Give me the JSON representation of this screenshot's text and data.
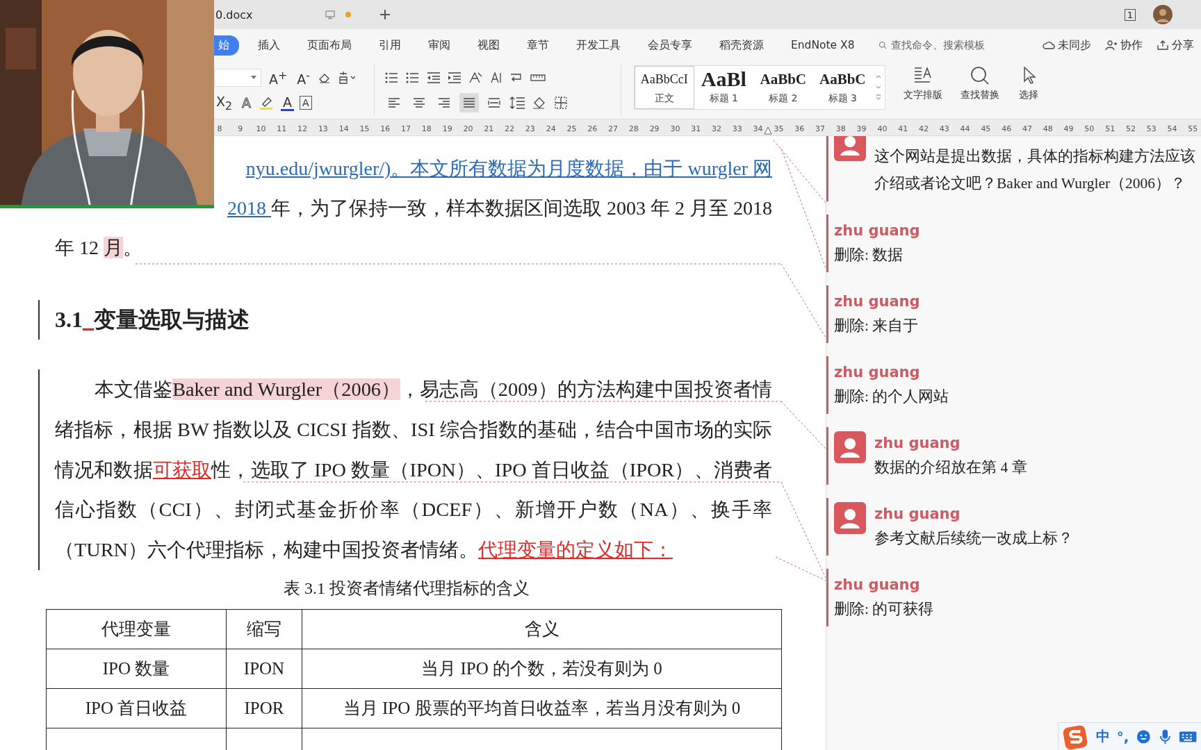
{
  "tab": {
    "title": "0.docx",
    "unsaved": true
  },
  "window_count": "1",
  "menu": [
    {
      "label": "始",
      "selected": true
    },
    {
      "label": "插入",
      "selected": false
    },
    {
      "label": "页面布局",
      "selected": false
    },
    {
      "label": "引用",
      "selected": false
    },
    {
      "label": "审阅",
      "selected": false
    },
    {
      "label": "视图",
      "selected": false
    },
    {
      "label": "章节",
      "selected": false
    },
    {
      "label": "开发工具",
      "selected": false
    },
    {
      "label": "会员专享",
      "selected": false
    },
    {
      "label": "稻壳资源",
      "selected": false
    },
    {
      "label": "EndNote X8",
      "selected": false
    }
  ],
  "search": {
    "placeholder": "查找命令、搜索模板"
  },
  "menu_right": [
    {
      "label": "未同步",
      "kind": "cloud"
    },
    {
      "label": "协作",
      "kind": "people"
    },
    {
      "label": "分享",
      "kind": "share"
    }
  ],
  "font_row1": [
    {
      "glyph": "A$^{+}$"
    },
    {
      "glyph": "A$^{-}$"
    }
  ],
  "font_row2": [
    {
      "glyph": "X$_{2}$",
      "kind": "plain"
    },
    {
      "glyph": "A",
      "kind": "outline"
    },
    {
      "kind": "highlight"
    },
    {
      "glyph": "A",
      "kind": "color"
    },
    {
      "glyph": "A",
      "kind": "boxed"
    }
  ],
  "alignment": [
    {
      "kind": "left",
      "selected": false
    },
    {
      "kind": "center",
      "selected": false
    },
    {
      "kind": "right",
      "selected": false
    },
    {
      "kind": "justify",
      "selected": true
    },
    {
      "kind": "distributed",
      "selected": false
    }
  ],
  "styles": [
    {
      "sample": "AaBbCcI",
      "label": "正文",
      "kind": "body",
      "selected": true
    },
    {
      "sample": "AaBl",
      "label": "标题 1",
      "kind": "h1",
      "selected": false
    },
    {
      "sample": "AaBbC",
      "label": "标题 2",
      "kind": "h2",
      "selected": false
    },
    {
      "sample": "AaBbC",
      "label": "标题 3",
      "kind": "h3",
      "selected": false
    }
  ],
  "tools": [
    {
      "label": "文字排版",
      "kind": "layout"
    },
    {
      "label": "查找替换",
      "kind": "find"
    },
    {
      "label": "选择",
      "kind": "select"
    }
  ],
  "ruler": [
    "8",
    "9",
    "10",
    "11",
    "12",
    "13",
    "14",
    "15",
    "16",
    "17",
    "18",
    "19",
    "20",
    "21",
    "22",
    "23",
    "24",
    "25",
    "26",
    "27",
    "28",
    "29",
    "30",
    "31",
    "32",
    "33",
    "34",
    "35",
    "36",
    "37",
    "38",
    "39",
    "40",
    "41",
    "42",
    "43",
    "44",
    "45",
    "46",
    "47",
    "48",
    "49",
    "50",
    "51",
    "52",
    "53",
    "54",
    "55"
  ],
  "document": {
    "intro_lines": [
      [
        {
          "text": "nyu.edu/jwurgler/)。本文所有数据为月度数据，由于 wurgler 网",
          "kind": "link"
        }
      ],
      [
        {
          "text": "2018 ",
          "kind": "link"
        },
        {
          "text": "年，为了保持一致，样本数据区间选取 2003 年 2 月至 2018",
          "kind": "normal"
        }
      ],
      [
        {
          "text": "年 12 ",
          "kind": "normal"
        },
        {
          "text": "月",
          "kind": "anchor"
        },
        {
          "text": "。",
          "kind": "normal"
        }
      ]
    ],
    "heading": [
      {
        "text": "3.1",
        "kind": "normal"
      },
      {
        "text": "_",
        "kind": "insertion"
      },
      {
        "text": "变量选取与描述",
        "kind": "normal"
      }
    ],
    "paragraph": [
      {
        "text": "本文借鉴",
        "kind": "normal"
      },
      {
        "text": "Baker and Wurgler（2006）",
        "kind": "anchor"
      },
      {
        "text": "，易志高（2009）的方法构建中国投资者情绪指标，根据 BW 指数以及 CICSI 指数、ISI 综合指数的基础，结合中国市场的实际情况和数据",
        "kind": "normal"
      },
      {
        "text": "可获取",
        "kind": "insertion"
      },
      {
        "text": "性，选取了 IPO 数量（IPON）、IPO 首日收益（IPOR）、消费者信心指数（CCI）、封闭式基金折价率（DCEF）、新增开户数（NA）、换手率（TURN）六个代理指标，构建中国投资者情绪。",
        "kind": "normal"
      },
      {
        "text": "代理变量的定义如下：",
        "kind": "insertion"
      }
    ],
    "caption": "表 3.1 投资者情绪代理指标的含义",
    "table": {
      "columns": [
        "代理变量",
        "缩写",
        "含义"
      ],
      "rows": [
        [
          "IPO 数量",
          "IPON",
          "当月 IPO 的个数，若没有则为 0"
        ],
        [
          "IPO 首日收益",
          "IPOR",
          "当月 IPO 股票的平均首日收益率，若当月没有则为 0"
        ]
      ]
    }
  },
  "comments": [
    {
      "kind": "comment",
      "lines": [
        "这个网站是提出数据，具体的指标构建方法应该",
        "介绍或者论文吧？Baker and Wurgler（2006）？"
      ]
    },
    {
      "kind": "deletion",
      "author": "zhu guang",
      "lines": [
        "删除: 数据"
      ]
    },
    {
      "kind": "deletion",
      "author": "zhu guang",
      "lines": [
        "删除: 来自于"
      ]
    },
    {
      "kind": "deletion",
      "author": "zhu guang",
      "lines": [
        "删除: 的个人网站"
      ]
    },
    {
      "kind": "comment",
      "author": "zhu guang",
      "lines": [
        "数据的介绍放在第 4 章"
      ]
    },
    {
      "kind": "comment",
      "author": "zhu guang",
      "lines": [
        "参考文献后续统一改成上标？"
      ]
    },
    {
      "kind": "deletion",
      "author": "zhu guang",
      "lines": [
        "删除: 的可获得"
      ]
    }
  ],
  "ime": {
    "labels": [
      "中",
      "°,"
    ]
  }
}
